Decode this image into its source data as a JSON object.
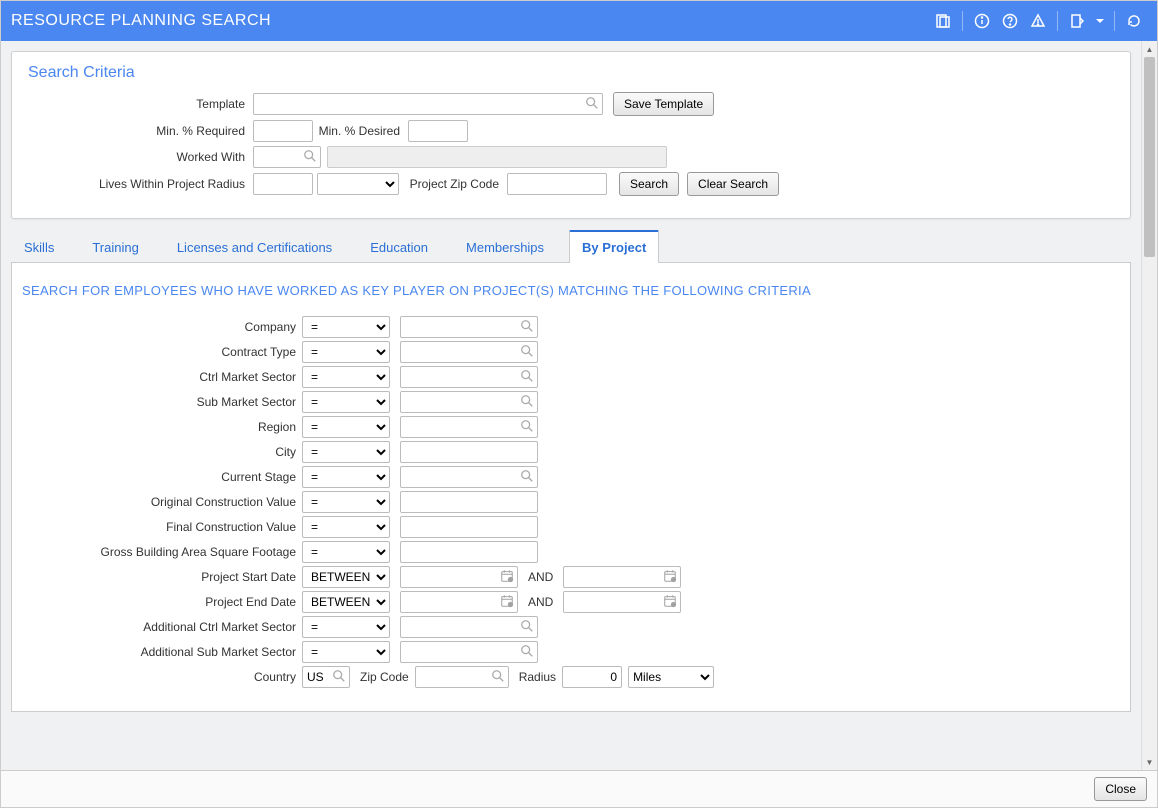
{
  "titlebar": {
    "title": "RESOURCE PLANNING SEARCH"
  },
  "panel": {
    "title": "Search Criteria",
    "template_label": "Template",
    "save_template": "Save Template",
    "min_required_label": "Min. % Required",
    "min_desired_label": "Min. % Desired",
    "worked_with_label": "Worked With",
    "lives_within_label": "Lives Within Project Radius",
    "project_zip_label": "Project Zip Code",
    "search_btn": "Search",
    "clear_btn": "Clear Search"
  },
  "tabs": [
    {
      "label": "Skills"
    },
    {
      "label": "Training"
    },
    {
      "label": "Licenses and Certifications"
    },
    {
      "label": "Education"
    },
    {
      "label": "Memberships"
    },
    {
      "label": "By Project"
    }
  ],
  "section_head": "SEARCH FOR EMPLOYEES WHO HAVE WORKED AS KEY PLAYER ON PROJECT(S) MATCHING THE FOLLOWING CRITERIA",
  "criteria": {
    "company": {
      "label": "Company",
      "op": "=",
      "type": "lookup"
    },
    "contract_type": {
      "label": "Contract Type",
      "op": "=",
      "type": "lookup"
    },
    "ctrl_market": {
      "label": "Ctrl Market Sector",
      "op": "=",
      "type": "lookup"
    },
    "sub_market": {
      "label": "Sub Market Sector",
      "op": "=",
      "type": "lookup"
    },
    "region": {
      "label": "Region",
      "op": "=",
      "type": "lookup"
    },
    "city": {
      "label": "City",
      "op": "=",
      "type": "text"
    },
    "current_stage": {
      "label": "Current Stage",
      "op": "=",
      "type": "lookup"
    },
    "orig_value": {
      "label": "Original Construction Value",
      "op": "=",
      "type": "text"
    },
    "final_value": {
      "label": "Final Construction Value",
      "op": "=",
      "type": "text"
    },
    "gross_area": {
      "label": "Gross Building Area Square Footage",
      "op": "=",
      "type": "text"
    },
    "start_date": {
      "label": "Project Start Date",
      "op": "BETWEEN",
      "type": "date",
      "and": "AND"
    },
    "end_date": {
      "label": "Project End Date",
      "op": "BETWEEN",
      "type": "date",
      "and": "AND"
    },
    "add_ctrl": {
      "label": "Additional Ctrl Market Sector",
      "op": "=",
      "type": "lookup"
    },
    "add_sub": {
      "label": "Additional Sub Market Sector",
      "op": "=",
      "type": "lookup"
    }
  },
  "country_row": {
    "country_label": "Country",
    "country_value": "US",
    "zip_label": "Zip Code",
    "radius_label": "Radius",
    "radius_value": "0",
    "radius_unit": "Miles"
  },
  "footer": {
    "close": "Close"
  }
}
